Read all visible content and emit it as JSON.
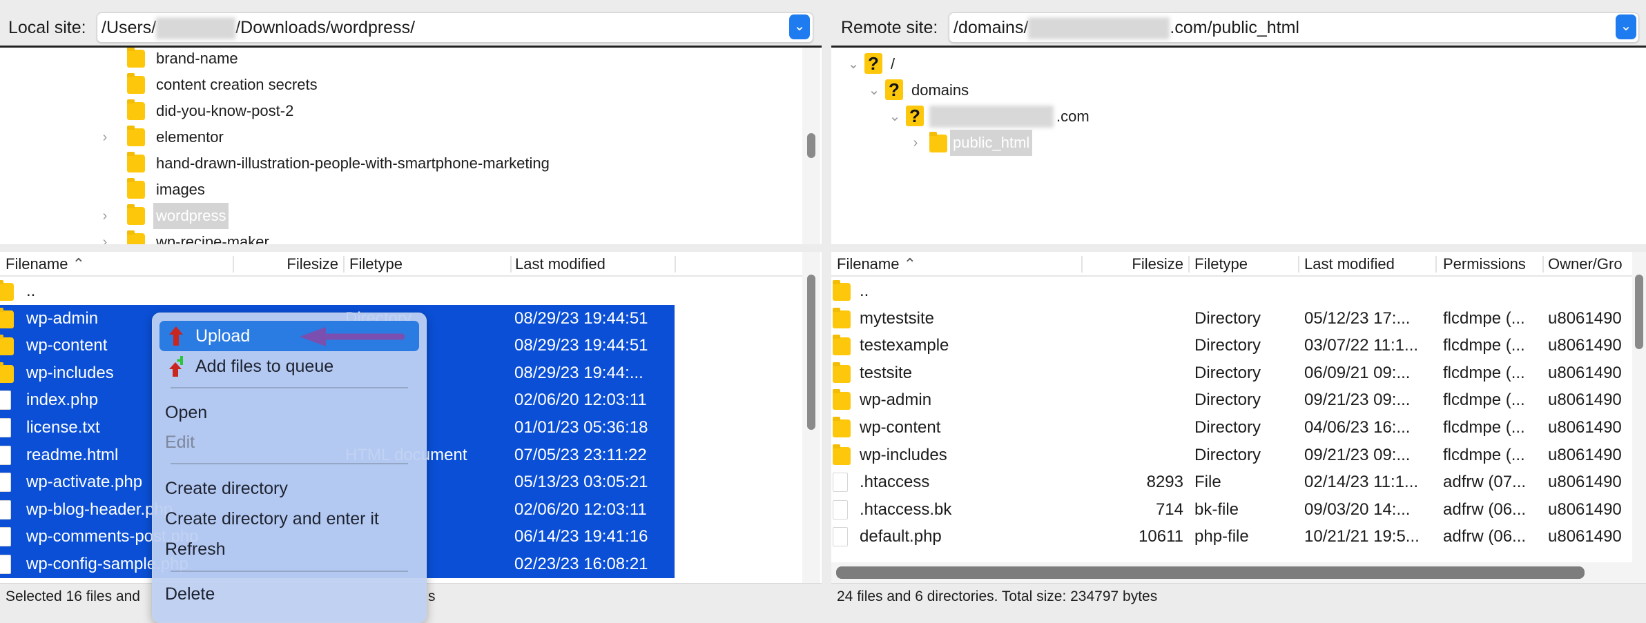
{
  "local": {
    "address_label": "Local site:",
    "address_prefix": "/Users/",
    "address_suffix": "/Downloads/wordpress/",
    "tree": [
      {
        "label": "brand-name",
        "expandable": false,
        "selected": false
      },
      {
        "label": "content creation secrets",
        "expandable": false,
        "selected": false
      },
      {
        "label": "did-you-know-post-2",
        "expandable": false,
        "selected": false
      },
      {
        "label": "elementor",
        "expandable": true,
        "selected": false
      },
      {
        "label": "hand-drawn-illustration-people-with-smartphone-marketing",
        "expandable": false,
        "selected": false
      },
      {
        "label": "images",
        "expandable": false,
        "selected": false
      },
      {
        "label": "wordpress",
        "expandable": true,
        "selected": true
      },
      {
        "label": "wp-recipe-maker",
        "expandable": true,
        "selected": false
      }
    ],
    "columns": {
      "filename": "Filename",
      "filesize": "Filesize",
      "filetype": "Filetype",
      "modified": "Last modified"
    },
    "rows": [
      {
        "name": "..",
        "size": "",
        "type": "",
        "modified": "",
        "icon": "folder",
        "selected": false
      },
      {
        "name": "wp-admin",
        "size": "",
        "type": "Directory",
        "modified": "08/29/23 19:44:51",
        "icon": "folder",
        "selected": true
      },
      {
        "name": "wp-content",
        "size": "",
        "type": "",
        "modified": "08/29/23 19:44:51",
        "icon": "folder",
        "selected": true
      },
      {
        "name": "wp-includes",
        "size": "",
        "type": "",
        "modified": "08/29/23 19:44:...",
        "icon": "folder",
        "selected": true
      },
      {
        "name": "index.php",
        "size": "",
        "type": "",
        "modified": "02/06/20 12:03:11",
        "icon": "file",
        "selected": true
      },
      {
        "name": "license.txt",
        "size": "",
        "type": "",
        "modified": "01/01/23 05:36:18",
        "icon": "file",
        "selected": true
      },
      {
        "name": "readme.html",
        "size": "",
        "type": "HTML document",
        "modified": "07/05/23 23:11:22",
        "icon": "file",
        "selected": true
      },
      {
        "name": "wp-activate.php",
        "size": "",
        "type": "",
        "modified": "05/13/23 03:05:21",
        "icon": "file",
        "selected": true
      },
      {
        "name": "wp-blog-header.php",
        "size": "",
        "type": "",
        "modified": "02/06/20 12:03:11",
        "icon": "file",
        "selected": true
      },
      {
        "name": "wp-comments-post.php",
        "size": "",
        "type": "",
        "modified": "06/14/23 19:41:16",
        "icon": "file",
        "selected": true
      },
      {
        "name": "wp-config-sample.php",
        "size": "",
        "type": "",
        "modified": "02/23/23 16:08:21",
        "icon": "file",
        "selected": true
      }
    ],
    "status": "Selected 16 files and",
    "status_tail": "s"
  },
  "remote": {
    "address_label": "Remote site:",
    "address_prefix": "/domains/",
    "address_suffix": ".com/public_html",
    "tree": [
      {
        "label": "/",
        "icon": "question",
        "expanded": true
      },
      {
        "label": "domains",
        "icon": "question",
        "expanded": true
      },
      {
        "label": ".com",
        "icon": "question",
        "expanded": true,
        "blurred": true
      },
      {
        "label": "public_html",
        "icon": "folder",
        "expanded": false,
        "selected": true
      }
    ],
    "columns": {
      "filename": "Filename",
      "filesize": "Filesize",
      "filetype": "Filetype",
      "modified": "Last modified",
      "permissions": "Permissions",
      "owner": "Owner/Gro"
    },
    "rows": [
      {
        "name": "..",
        "size": "",
        "type": "",
        "modified": "",
        "perms": "",
        "owner": "",
        "icon": "folder"
      },
      {
        "name": "mytestsite",
        "size": "",
        "type": "Directory",
        "modified": "05/12/23 17:...",
        "perms": "flcdmpe (...",
        "owner": "u8061490",
        "icon": "folder"
      },
      {
        "name": "testexample",
        "size": "",
        "type": "Directory",
        "modified": "03/07/22 11:1...",
        "perms": "flcdmpe (...",
        "owner": "u8061490",
        "icon": "folder"
      },
      {
        "name": "testsite",
        "size": "",
        "type": "Directory",
        "modified": "06/09/21 09:...",
        "perms": "flcdmpe (...",
        "owner": "u8061490",
        "icon": "folder"
      },
      {
        "name": "wp-admin",
        "size": "",
        "type": "Directory",
        "modified": "09/21/23 09:...",
        "perms": "flcdmpe (...",
        "owner": "u8061490",
        "icon": "folder"
      },
      {
        "name": "wp-content",
        "size": "",
        "type": "Directory",
        "modified": "04/06/23 16:...",
        "perms": "flcdmpe (...",
        "owner": "u8061490",
        "icon": "folder"
      },
      {
        "name": "wp-includes",
        "size": "",
        "type": "Directory",
        "modified": "09/21/23 09:...",
        "perms": "flcdmpe (...",
        "owner": "u8061490",
        "icon": "folder"
      },
      {
        "name": ".htaccess",
        "size": "8293",
        "type": "File",
        "modified": "02/14/23 11:1...",
        "perms": "adfrw (07...",
        "owner": "u8061490",
        "icon": "file"
      },
      {
        "name": ".htaccess.bk",
        "size": "714",
        "type": "bk-file",
        "modified": "09/03/20 14:...",
        "perms": "adfrw (06...",
        "owner": "u8061490",
        "icon": "file"
      },
      {
        "name": "default.php",
        "size": "10611",
        "type": "php-file",
        "modified": "10/21/21 19:5...",
        "perms": "adfrw (06...",
        "owner": "u8061490",
        "icon": "file"
      }
    ],
    "status": "24 files and 6 directories. Total size: 234797 bytes"
  },
  "context_menu": {
    "items": [
      {
        "label": "Upload",
        "highlighted": true,
        "icon": "upload-icon"
      },
      {
        "label": "Add files to queue",
        "icon": "add-to-queue-icon"
      },
      {
        "label": "Open"
      },
      {
        "label": "Edit",
        "disabled": true
      },
      {
        "label": "Create directory"
      },
      {
        "label": "Create directory and enter it"
      },
      {
        "label": "Refresh"
      },
      {
        "label": "Delete"
      }
    ]
  },
  "colors": {
    "selection": "#0a4fd6",
    "menu_highlight": "#2a7be2",
    "annotation_arrow": "#7b4fb0",
    "folder": "#fdc80c"
  }
}
